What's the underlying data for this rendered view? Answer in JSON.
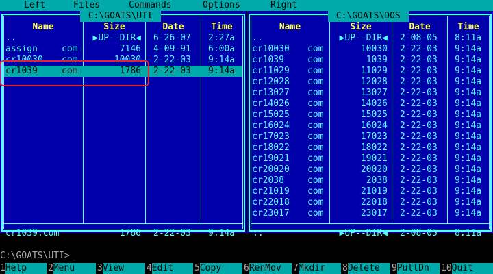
{
  "menubar": {
    "left": "Left",
    "files": "Files",
    "commands": "Commands",
    "options": "Options",
    "right": "Right"
  },
  "left_panel": {
    "path": " C:\\GOATS\\UTI ",
    "headers": {
      "name": "Name",
      "size": "Size",
      "date": "Date",
      "time": "Time"
    },
    "rows": [
      {
        "name": "..",
        "ext": "",
        "size": "▶UP--DIR◀",
        "date": "6-26-07",
        "time": "2:27a"
      },
      {
        "name": "assign",
        "ext": "com",
        "size": "7146",
        "date": "4-09-91",
        "time": "6:00a"
      },
      {
        "name": "cr10030",
        "ext": "com",
        "size": "10030",
        "date": "2-22-03",
        "time": "9:14a"
      },
      {
        "name": "cr1039",
        "ext": "com",
        "size": "1786",
        "date": "2-22-03",
        "time": "9:14a"
      }
    ],
    "selected_index": 3,
    "status": {
      "name": "cr1039.com",
      "size": "1786",
      "date": "2-22-03",
      "time": "9:14a"
    }
  },
  "right_panel": {
    "path": " C:\\GOATS\\DOS ",
    "headers": {
      "name": "Name",
      "size": "Size",
      "date": "Date",
      "time": "Time"
    },
    "rows": [
      {
        "name": "..",
        "ext": "",
        "size": "▶UP--DIR◀",
        "date": "2-08-05",
        "time": "8:11a"
      },
      {
        "name": "cr10030",
        "ext": "com",
        "size": "10030",
        "date": "2-22-03",
        "time": "9:14a"
      },
      {
        "name": "cr1039",
        "ext": "com",
        "size": "1039",
        "date": "2-22-03",
        "time": "9:14a"
      },
      {
        "name": "cr11029",
        "ext": "com",
        "size": "11029",
        "date": "2-22-03",
        "time": "9:14a"
      },
      {
        "name": "cr12028",
        "ext": "com",
        "size": "12028",
        "date": "2-22-03",
        "time": "9:14a"
      },
      {
        "name": "cr13027",
        "ext": "com",
        "size": "13027",
        "date": "2-22-03",
        "time": "9:14a"
      },
      {
        "name": "cr14026",
        "ext": "com",
        "size": "14026",
        "date": "2-22-03",
        "time": "9:14a"
      },
      {
        "name": "cr15025",
        "ext": "com",
        "size": "15025",
        "date": "2-22-03",
        "time": "9:14a"
      },
      {
        "name": "cr16024",
        "ext": "com",
        "size": "16024",
        "date": "2-22-03",
        "time": "9:14a"
      },
      {
        "name": "cr17023",
        "ext": "com",
        "size": "17023",
        "date": "2-22-03",
        "time": "9:14a"
      },
      {
        "name": "cr18022",
        "ext": "com",
        "size": "18022",
        "date": "2-22-03",
        "time": "9:14a"
      },
      {
        "name": "cr19021",
        "ext": "com",
        "size": "19021",
        "date": "2-22-03",
        "time": "9:14a"
      },
      {
        "name": "cr20020",
        "ext": "com",
        "size": "20020",
        "date": "2-22-03",
        "time": "9:14a"
      },
      {
        "name": "cr2038",
        "ext": "com",
        "size": "2038",
        "date": "2-22-03",
        "time": "9:14a"
      },
      {
        "name": "cr21019",
        "ext": "com",
        "size": "21019",
        "date": "2-22-03",
        "time": "9:14a"
      },
      {
        "name": "cr22018",
        "ext": "com",
        "size": "22018",
        "date": "2-22-03",
        "time": "9:14a"
      },
      {
        "name": "cr23017",
        "ext": "com",
        "size": "23017",
        "date": "2-22-03",
        "time": "9:14a"
      }
    ],
    "status": {
      "name": "..",
      "size": "▶UP--DIR◀",
      "date": "2-08-05",
      "time": "8:11a"
    }
  },
  "command_line": {
    "prompt": "C:\\GOATS\\UTI>",
    "cursor": "_"
  },
  "function_keys": [
    {
      "num": "1",
      "label": "Help"
    },
    {
      "num": "2",
      "label": "Menu"
    },
    {
      "num": "3",
      "label": "View"
    },
    {
      "num": "4",
      "label": "Edit"
    },
    {
      "num": "5",
      "label": "Copy"
    },
    {
      "num": "6",
      "label": "RenMov"
    },
    {
      "num": "7",
      "label": "Mkdir"
    },
    {
      "num": "8",
      "label": "Delete"
    },
    {
      "num": "9",
      "label": "PullDn"
    },
    {
      "num": "10",
      "label": "Quit"
    }
  ],
  "colors": {
    "panel_bg": "#0000aa",
    "text": "#55ffff",
    "header": "#ffff55",
    "highlight": "#00aaaa",
    "annotation": "#e8202a"
  }
}
